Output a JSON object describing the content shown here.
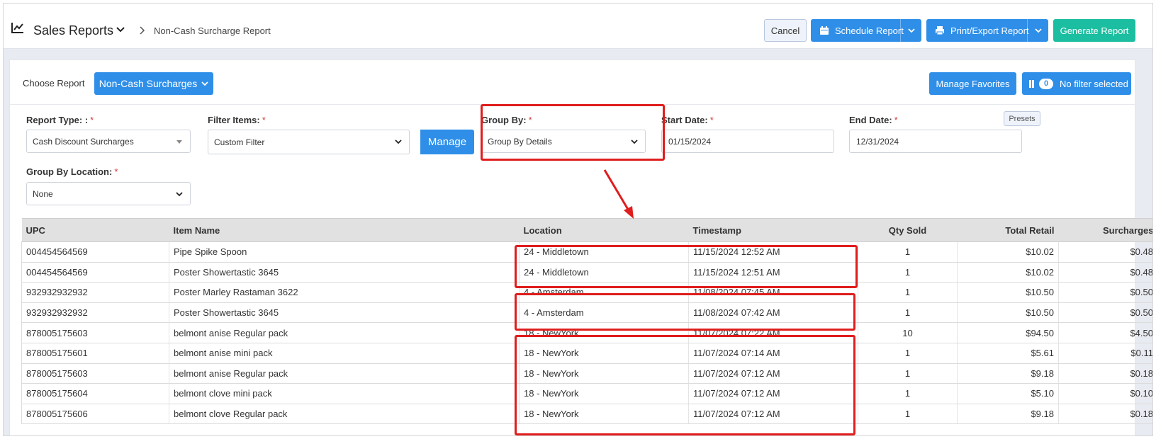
{
  "header": {
    "title": "Sales Reports",
    "breadcrumb": "Non-Cash Surcharge Report",
    "cancel_label": "Cancel",
    "schedule_label": "Schedule Report",
    "print_label": "Print/Export Report",
    "generate_label": "Generate Report"
  },
  "toolbar": {
    "choose_report_label": "Choose Report",
    "report_button_label": "Non-Cash Surcharges",
    "manage_favorites_label": "Manage Favorites",
    "filter_count": "0",
    "filter_label": "No filter selected"
  },
  "filters": {
    "report_type_label": "Report Type: :",
    "report_type_value": "Cash Discount Surcharges",
    "filter_items_label": "Filter Items:",
    "filter_items_value": "Custom Filter",
    "manage_label": "Manage",
    "group_by_label": "Group By:",
    "group_by_value": "Group By Details",
    "start_date_label": "Start Date:",
    "start_date_value": "01/15/2024",
    "end_date_label": "End Date:",
    "end_date_value": "12/31/2024",
    "presets_label": "Presets",
    "group_by_location_label": "Group By Location:",
    "group_by_location_value": "None",
    "required_mark": "*"
  },
  "table": {
    "headers": [
      "UPC",
      "Item Name",
      "Location",
      "Timestamp",
      "Qty Sold",
      "Total Retail",
      "Surcharges"
    ],
    "rows": [
      [
        "004454564569",
        "Pipe Spike Spoon",
        "24 - Middletown",
        "11/15/2024 12:52 AM",
        "1",
        "$10.02",
        "$0.48"
      ],
      [
        "004454564569",
        "Poster Showertastic 3645",
        "24 - Middletown",
        "11/15/2024 12:51 AM",
        "1",
        "$10.02",
        "$0.48"
      ],
      [
        "932932932932",
        "Poster Marley Rastaman 3622",
        "4 - Amsterdam",
        "11/08/2024 07:45 AM",
        "1",
        "$10.50",
        "$0.50"
      ],
      [
        "932932932932",
        "Poster Showertastic 3645",
        "4 - Amsterdam",
        "11/08/2024 07:42 AM",
        "1",
        "$10.50",
        "$0.50"
      ],
      [
        "878005175603",
        "belmont anise Regular pack",
        "18 - NewYork",
        "11/07/2024 07:22 AM",
        "10",
        "$94.50",
        "$4.50"
      ],
      [
        "878005175601",
        "belmont anise mini pack",
        "18 - NewYork",
        "11/07/2024 07:14 AM",
        "1",
        "$5.61",
        "$0.11"
      ],
      [
        "878005175603",
        "belmont anise Regular pack",
        "18 - NewYork",
        "11/07/2024 07:12 AM",
        "1",
        "$9.18",
        "$0.18"
      ],
      [
        "878005175604",
        "belmont clove mini pack",
        "18 - NewYork",
        "11/07/2024 07:12 AM",
        "1",
        "$5.10",
        "$0.10"
      ],
      [
        "878005175606",
        "belmont clove Regular pack",
        "18 - NewYork",
        "11/07/2024 07:12 AM",
        "1",
        "$9.18",
        "$0.18"
      ]
    ]
  },
  "colors": {
    "primary": "#2f8fe8",
    "success": "#1bbea0",
    "highlight": "#e01d1d"
  }
}
